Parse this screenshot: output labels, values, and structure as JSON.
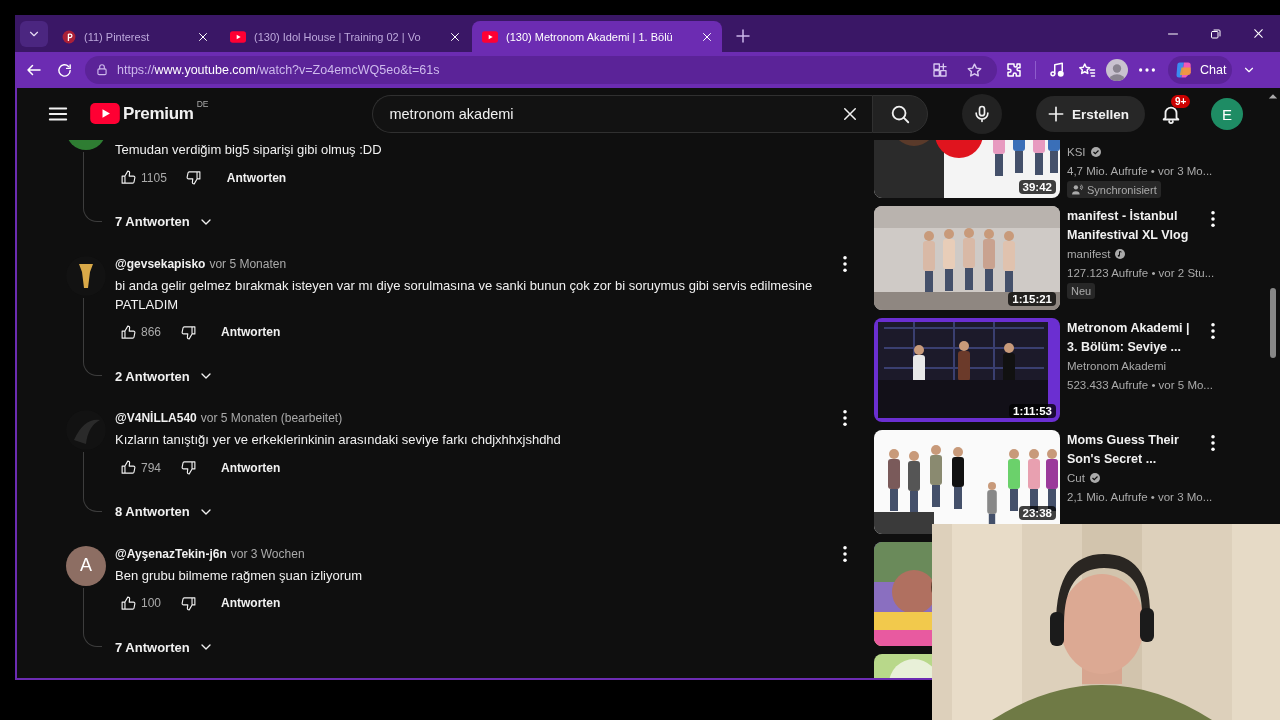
{
  "browser": {
    "tabs": [
      {
        "title": "(11) Pinterest",
        "kind": "pinterest",
        "selected": false
      },
      {
        "title": "(130) Idol House | Training 02 | Vo",
        "kind": "youtube",
        "selected": false
      },
      {
        "title": "(130) Metronom Akademi | 1. Bölü",
        "kind": "youtube",
        "selected": true
      }
    ],
    "url": "https://**www.youtube.com**/watch?v=Zo4emcWQ5eo&t=61s",
    "chat_label": "Chat"
  },
  "header": {
    "logo_text": "Premium",
    "region": "DE",
    "search_value": "metronom akademi",
    "create_label": "Erstellen",
    "notification_count": "9+",
    "account_initial": "E"
  },
  "comments": [
    {
      "avatar": {
        "kind": "letter",
        "color": "#2e7d32"
      },
      "text": "Temudan verdiğim big5 siparişi gibi olmuş :DD",
      "likes": "1105",
      "reply_label": "Antworten",
      "replies": "7 Antworten"
    },
    {
      "author": "@gevsekapisko",
      "time": "vor 5 Monaten",
      "text": "bi anda gelir gelmez bırakmak isteyen var mı diye sorulmasına ve sanki bunun çok zor bi soruymus gibi servis edilmesine PATLADIM",
      "likes": "866",
      "reply_label": "Antworten",
      "replies": "2 Antworten"
    },
    {
      "author": "@V4NİLLA540",
      "time": "vor 5 Monaten (bearbeitet)",
      "text": "Kızların tanıştığı yer ve erkeklerinkinin arasındaki seviye farkı chdjxhhxjshdhd",
      "likes": "794",
      "reply_label": "Antworten",
      "replies": "8 Antworten"
    },
    {
      "avatar": {
        "kind": "letter",
        "letter": "A",
        "color": "#8d6e63"
      },
      "author": "@AyşenazTekin-j6n",
      "time": "vor 3 Wochen",
      "text": "Ben grubu bilmeme rağmen şuan izliyorum",
      "likes": "100",
      "reply_label": "Antworten",
      "replies": "7 Antworten"
    }
  ],
  "sidebar": {
    "videos": [
      {
        "kind": "video",
        "channel": "KSI",
        "verified": true,
        "artist": false,
        "meta": "4,7 Mio. Aufrufe • vor 3 Mo...",
        "badge": {
          "kind": "dubbed",
          "label": "Synchronisiert"
        },
        "duration": "39:42",
        "menu": false
      },
      {
        "kind": "video",
        "title": "manifest - İstanbul Manifestival XL Vlog",
        "channel": "manifest",
        "verified": true,
        "artist": true,
        "meta": "127.123 Aufrufe • vor 2 Stu...",
        "badge": {
          "kind": "plain",
          "label": "Neu"
        },
        "duration": "1:15:21",
        "menu": true
      },
      {
        "kind": "video",
        "title": "Metronom Akademi | 3. Bölüm: Seviye ...",
        "channel": "Metronom Akademi",
        "verified": false,
        "meta": "523.433 Aufrufe • vor 5 Mo...",
        "duration": "1:11:53",
        "menu": true
      },
      {
        "kind": "video",
        "title": "Moms Guess Their Son's Secret ...",
        "channel": "Cut",
        "verified": true,
        "artist": false,
        "meta": "2,1 Mio. Aufrufe • vor 3 Mo...",
        "duration": "23:38",
        "menu": true
      },
      {
        "kind": "thumbnail"
      },
      {
        "kind": "thumbnail"
      }
    ]
  }
}
